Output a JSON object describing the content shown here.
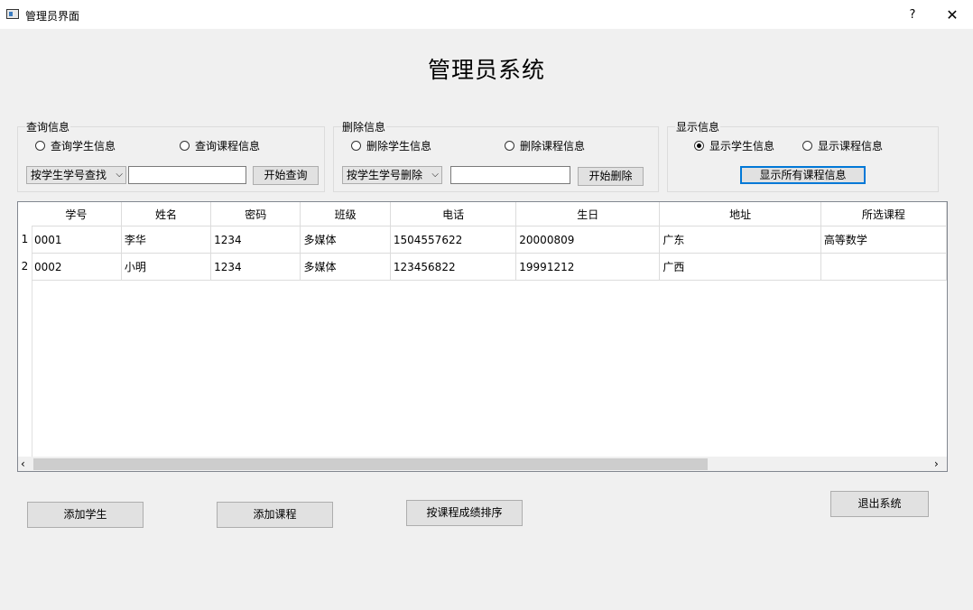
{
  "window": {
    "title": "管理员界面",
    "help": "?",
    "close": "✕"
  },
  "main_title": "管理员系统",
  "query": {
    "legend": "查询信息",
    "radio_student": "查询学生信息",
    "radio_course": "查询课程信息",
    "combo_value": "按学生学号查找",
    "input_value": "",
    "button": "开始查询"
  },
  "delete": {
    "legend": "删除信息",
    "radio_student": "删除学生信息",
    "radio_course": "删除课程信息",
    "combo_value": "按学生学号删除",
    "input_value": "",
    "button": "开始删除"
  },
  "display": {
    "legend": "显示信息",
    "radio_student": "显示学生信息",
    "radio_student_checked": true,
    "radio_course": "显示课程信息",
    "button": "显示所有课程信息"
  },
  "table": {
    "columns": [
      "学号",
      "姓名",
      "密码",
      "班级",
      "电话",
      "生日",
      "地址",
      "所选课程"
    ],
    "row_numbers": [
      "1",
      "2"
    ],
    "rows": [
      [
        "0001",
        "李华",
        "1234",
        "多媒体",
        "1504557622",
        "20000809",
        "广东",
        "高等数学"
      ],
      [
        "0002",
        "小明",
        "1234",
        "多媒体",
        "123456822",
        "19991212",
        "广西",
        ""
      ]
    ]
  },
  "scroll": {
    "left": "‹",
    "right": "›"
  },
  "buttons": {
    "add_student": "添加学生",
    "add_course": "添加课程",
    "sort_by_score": "按课程成绩排序",
    "exit": "退出系统"
  }
}
